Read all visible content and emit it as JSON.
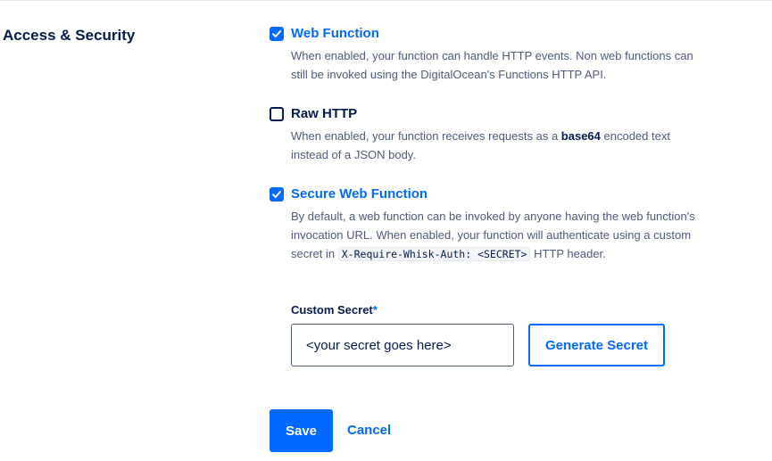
{
  "section": {
    "title": "Access & Security"
  },
  "options": {
    "web_function": {
      "label": "Web Function",
      "checked": true,
      "description": "When enabled, your function can handle HTTP events. Non web functions can still be invoked using the DigitalOcean's Functions HTTP API."
    },
    "raw_http": {
      "label": "Raw HTTP",
      "checked": false,
      "description_prefix": "When enabled, your function receives requests as a ",
      "description_bold": "base64",
      "description_suffix": " encoded text instead of a JSON body."
    },
    "secure_web_function": {
      "label": "Secure Web Function",
      "checked": true,
      "description_prefix": "By default, a web function can be invoked by anyone having the web function's invocation URL. When enabled, your function will authenticate using a custom secret in ",
      "description_code": "X-Require-Whisk-Auth: <SECRET>",
      "description_suffix": " HTTP header."
    }
  },
  "custom_secret": {
    "label": "Custom Secret",
    "required_marker": "*",
    "value": "<your secret goes here>",
    "generate_label": "Generate Secret"
  },
  "actions": {
    "save_label": "Save",
    "cancel_label": "Cancel"
  },
  "colors": {
    "accent": "#0069ff",
    "text": "#031b4e",
    "muted": "#4d5b7c"
  }
}
